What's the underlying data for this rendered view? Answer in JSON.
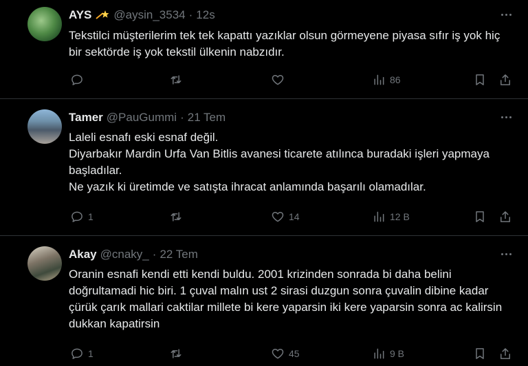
{
  "colors": {
    "background": "#000000",
    "text": "#e7e9ea",
    "muted": "#71767b",
    "divider": "#2f3336"
  },
  "tweets": [
    {
      "name": "AYS",
      "badge": "shooting-star-emoji",
      "handle": "@aysin_3534",
      "dot": "·",
      "time": "12s",
      "text": "Tekstilci müşterilerim tek tek kapattı yazıklar olsun görmeyene piyasa sıfır iş yok hiç bir sektörde iş yok tekstil ülkenin nabzıdır.",
      "replies": "",
      "retweets": "",
      "likes": "",
      "views": "86"
    },
    {
      "name": "Tamer",
      "handle": "@PauGummi",
      "dot": "·",
      "time": "21 Tem",
      "text": "Laleli esnafı eski esnaf değil.\nDiyarbakır Mardin Urfa Van Bitlis avanesi ticarete atılınca buradaki işleri yapmaya başladılar.\nNe yazık ki üretimde ve satışta ihracat anlamında başarılı olamadılar.",
      "replies": "1",
      "retweets": "",
      "likes": "14",
      "views": "12 B"
    },
    {
      "name": "Akay",
      "handle": "@cnaky_",
      "dot": "·",
      "time": "22 Tem",
      "text": "Oranin esnafi kendi etti kendi buldu. 2001 krizinden sonrada bi daha belini doğrultamadi hic biri. 1 çuval malın ust 2 sirasi duzgun sonra çuvalin dibine kadar çürük çarık mallari caktilar millete bi kere yaparsin iki kere yaparsin sonra ac kalirsin dukkan kapatirsin",
      "replies": "1",
      "retweets": "",
      "likes": "45",
      "views": "9 B"
    }
  ]
}
